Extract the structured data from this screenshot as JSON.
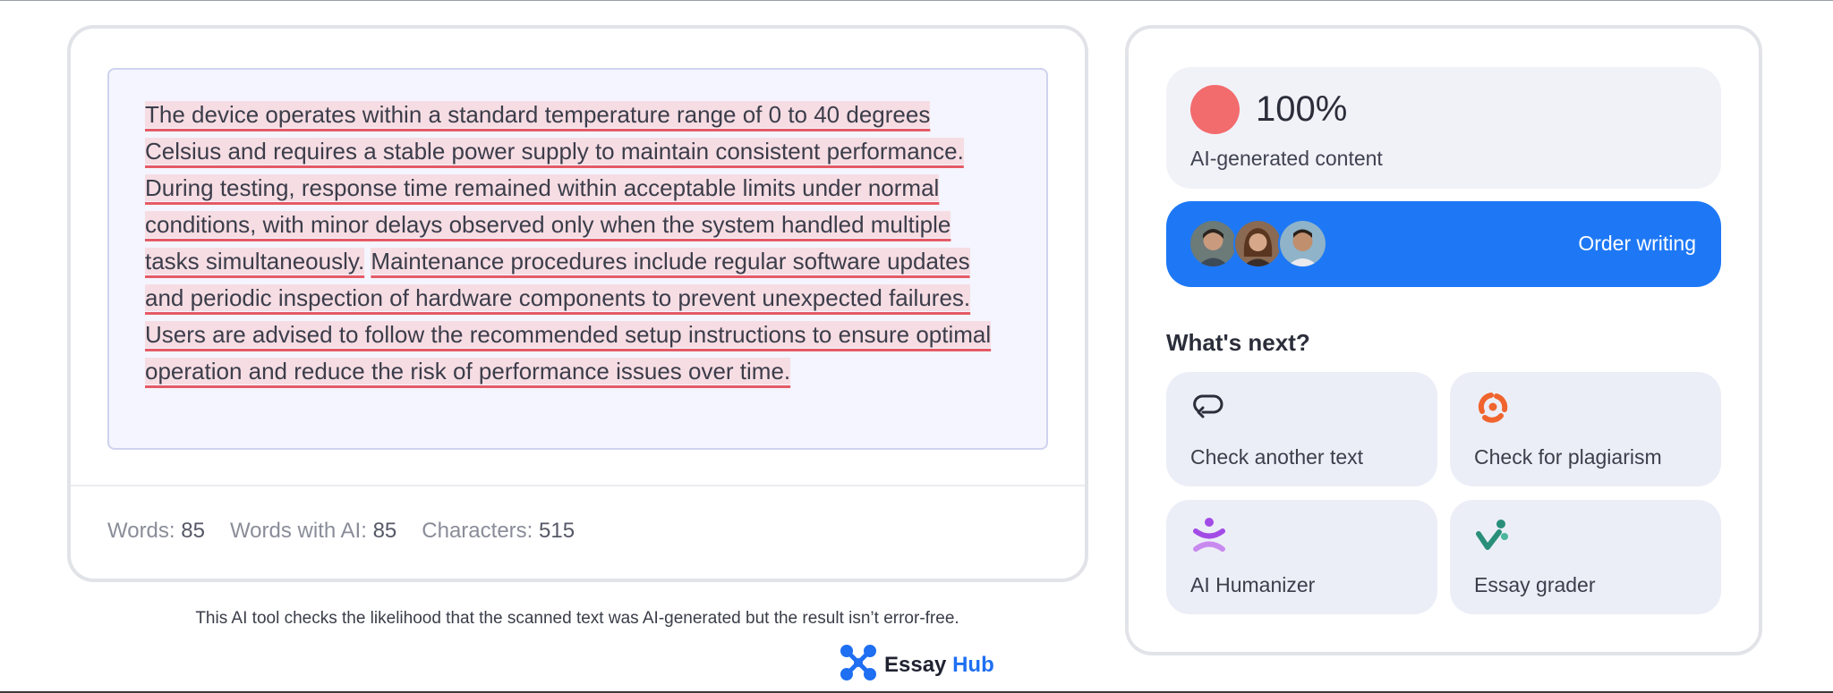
{
  "analysis": {
    "sentences": [
      "The device operates within a standard temperature range of 0 to 40 degrees Celsius and requires a stable power supply to maintain consistent performance.",
      "During testing, response time remained within acceptable limits under normal conditions, with minor delays observed only when the system handled multiple tasks simultaneously.",
      "Maintenance procedures include regular software updates and periodic inspection of hardware components to prevent unexpected failures.",
      "Users are advised to follow the recommended setup instructions to ensure optimal operation and reduce the risk of performance issues over time."
    ]
  },
  "stats": {
    "words_label": "Words:",
    "words_value": "85",
    "ai_words_label": "Words with AI:",
    "ai_words_value": "85",
    "chars_label": "Characters:",
    "chars_value": "515"
  },
  "disclaimer": "This AI tool checks the likelihood that the scanned text was AI-generated but the result isn’t error-free.",
  "brand": {
    "name": "Essay",
    "suffix": "Hub"
  },
  "result": {
    "percent": "100%",
    "label": "AI-generated content",
    "indicator_color": "#f26b6d"
  },
  "order": {
    "label": "Order writing"
  },
  "next": {
    "heading": "What's next?",
    "tiles": [
      {
        "label": "Check another text",
        "icon": "refresh-loop-icon"
      },
      {
        "label": "Check for plagiarism",
        "icon": "plagiarism-orbit-icon"
      },
      {
        "label": "AI Humanizer",
        "icon": "humanizer-person-icon"
      },
      {
        "label": "Essay grader",
        "icon": "grader-check-icon"
      }
    ]
  },
  "colors": {
    "accent": "#1e78f5",
    "highlight": "#f6dde3",
    "underline": "#e55a65"
  }
}
